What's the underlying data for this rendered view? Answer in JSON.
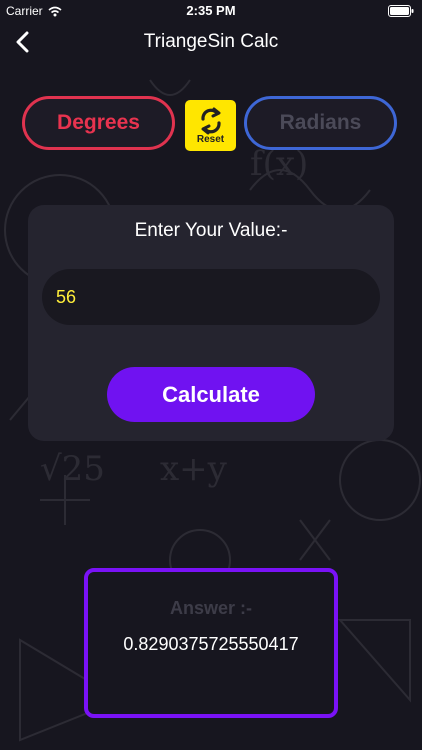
{
  "status_bar": {
    "carrier": "Carrier",
    "time": "2:35 PM"
  },
  "nav": {
    "title": "TriangeSin Calc"
  },
  "mode": {
    "degrees_label": "Degrees",
    "reset_label": "Reset",
    "radians_label": "Radians",
    "selected": "Degrees"
  },
  "input_card": {
    "title": "Enter Your Value:-",
    "value": "56",
    "calculate_label": "Calculate"
  },
  "answer": {
    "label": "Answer :-",
    "value": "0.8290375725550417"
  },
  "colors": {
    "background": "#17161f",
    "degrees_accent": "#e0334f",
    "radians_accent": "#3e67d6",
    "reset_bg": "#ffe600",
    "primary": "#7012f1",
    "input_text": "#ffee3a"
  },
  "icons": {
    "back": "chevron-left-icon",
    "wifi": "wifi-icon",
    "battery": "battery-icon",
    "reset": "refresh-icon"
  }
}
